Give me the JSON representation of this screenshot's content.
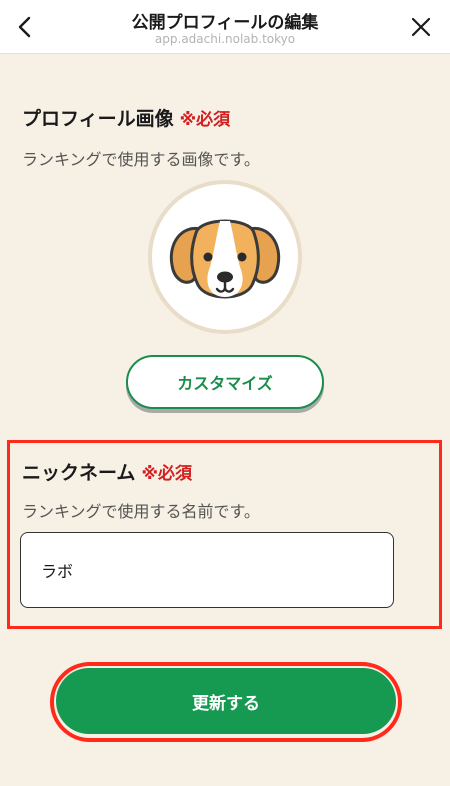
{
  "header": {
    "title": "公開プロフィールの編集",
    "url": "app.adachi.nolab.tokyo",
    "back_icon": "chevron-left-icon",
    "close_icon": "close-icon"
  },
  "profile_image": {
    "label": "プロフィール画像",
    "required": "※必須",
    "description": "ランキングで使用する画像です。",
    "avatar_icon": "beagle-dog-icon",
    "customize_label": "カスタマイズ"
  },
  "nickname": {
    "label": "ニックネーム",
    "required": "※必須",
    "description": "ランキングで使用する名前です。",
    "value": "ラボ"
  },
  "submit_label": "更新する",
  "colors": {
    "background": "#f6f0e5",
    "accent_green": "#169a52",
    "required_red": "#d31f1f",
    "highlight_red": "#ff2a1a"
  }
}
